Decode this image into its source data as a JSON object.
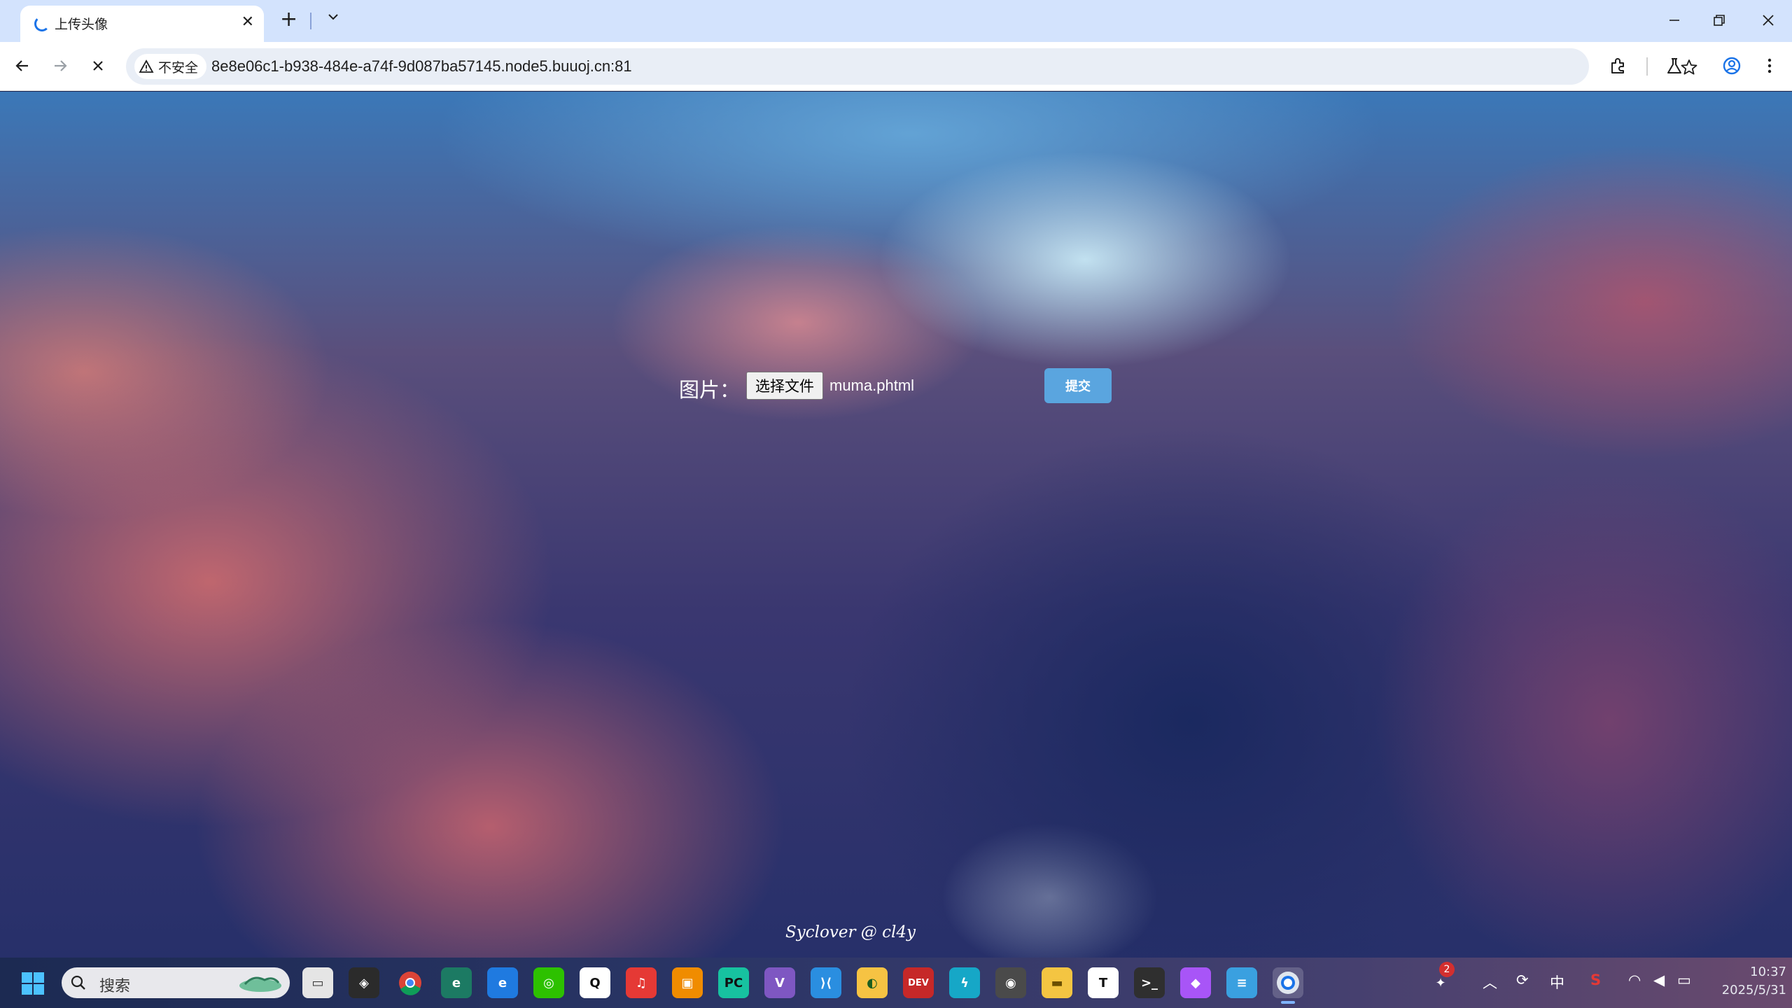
{
  "browser": {
    "tab": {
      "title": "上传头像"
    },
    "omnibox": {
      "security_label": "不安全",
      "url": "8e8e06c1-b938-484e-a74f-9d087ba57145.node5.buuoj.cn:81"
    }
  },
  "page": {
    "form": {
      "label": "图片：",
      "choose_file_label": "选择文件",
      "file_name": "muma.phtml",
      "submit_label": "提交"
    },
    "footer_credit": "Syclover @ cl4y"
  },
  "taskbar": {
    "search_placeholder": "搜索",
    "apps": [
      "start-menu",
      "search",
      "task-view",
      "unity",
      "chrome",
      "edge-dev",
      "edge",
      "wechat",
      "qq",
      "netease-music",
      "remote-desktop",
      "pycharm",
      "visual-studio",
      "vscode",
      "qq-browser",
      "dev-cpp",
      "typora-lightning",
      "obs",
      "file-explorer",
      "typora",
      "terminal",
      "rider",
      "notepad",
      "chrome-active"
    ],
    "tray": {
      "notification_count": "2",
      "ime_label": "中",
      "time": "10:37",
      "date": "2025/5/31"
    }
  },
  "colors": {
    "tab_strip": "#d3e3fd",
    "submit_button": "#5aa5df",
    "accent": "#1a73e8"
  }
}
